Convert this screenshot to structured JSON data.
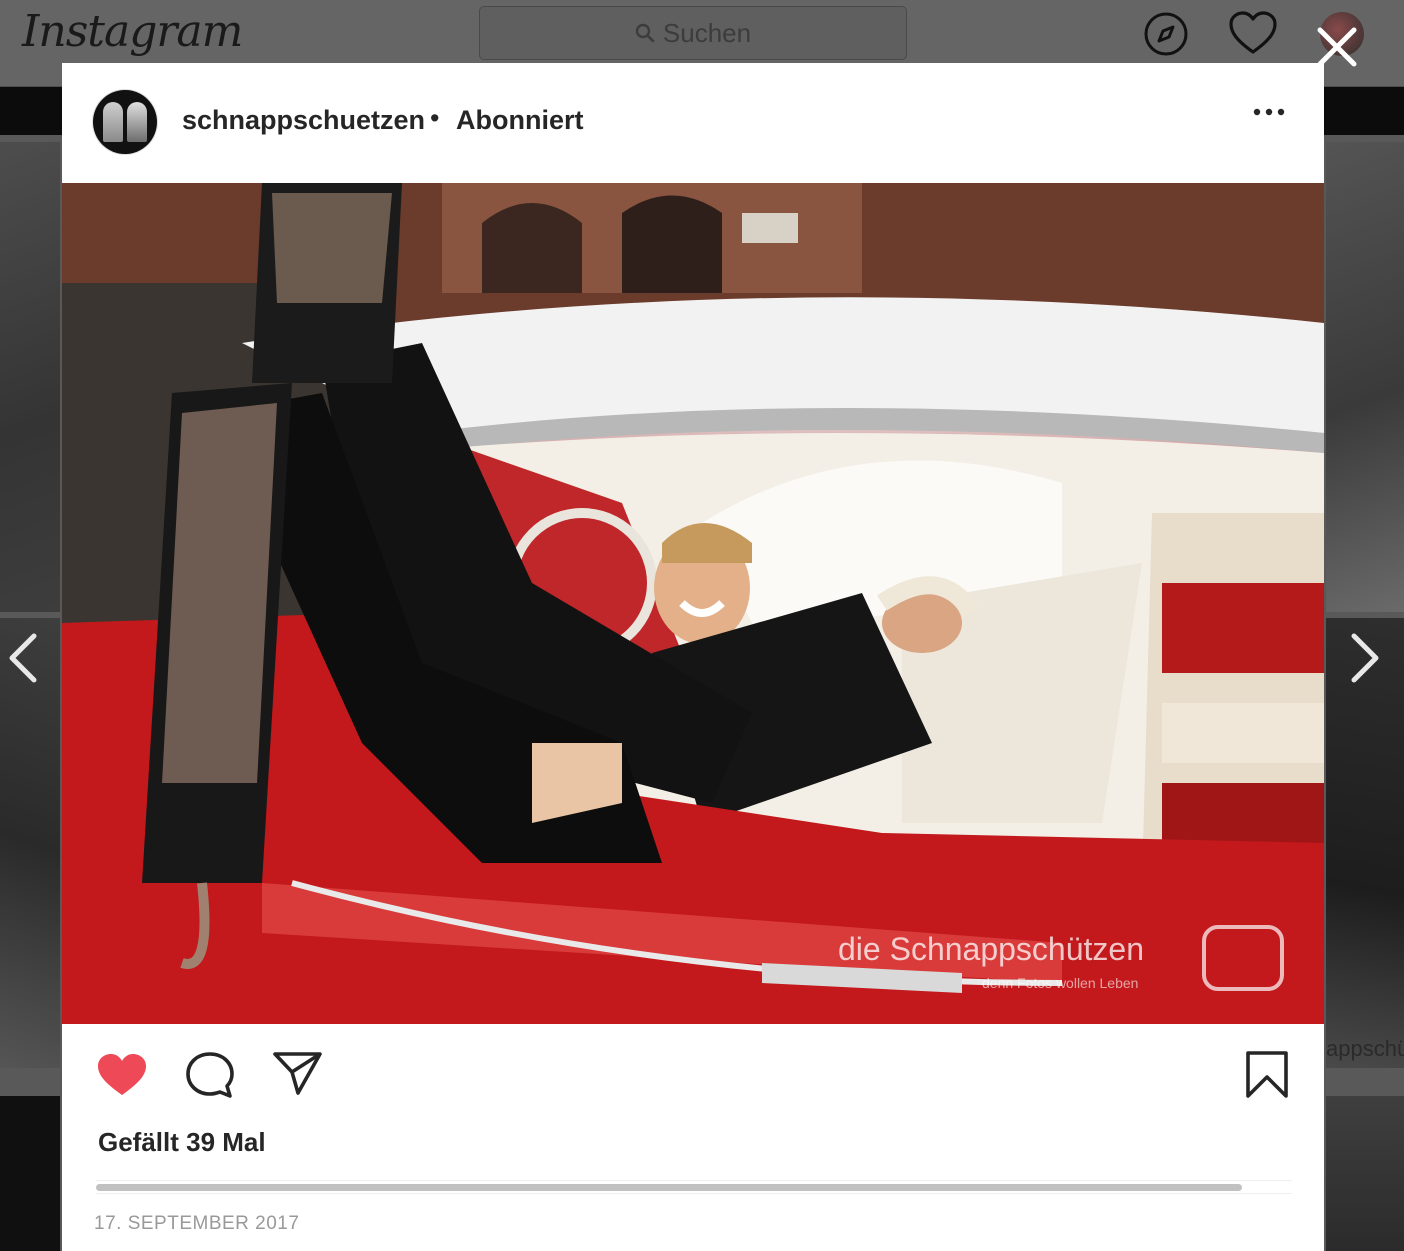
{
  "app": {
    "logo_text": "Instagram",
    "search_placeholder": "Suchen"
  },
  "background": {
    "right_partial_text": "appschü"
  },
  "post": {
    "username": "schnappschuetzen",
    "separator": "•",
    "follow_status": "Abonniert",
    "photo": {
      "watermark": "die Schnappschützen",
      "watermark_tagline": "denn Fotos wollen Leben"
    },
    "liked": true,
    "likes_text": "Gefällt 39 Mal",
    "date": "17. SEPTEMBER 2017"
  },
  "colors": {
    "like_red": "#ed4956",
    "text_dark": "#262626",
    "text_muted": "#999999",
    "overlay": "#595959"
  },
  "icons": {
    "search": "search-icon",
    "explore": "compass-icon",
    "activity": "heart-outline-icon",
    "close": "close-icon",
    "more": "more-options-icon",
    "like": "heart-filled-icon",
    "comment": "comment-icon",
    "share": "paper-plane-icon",
    "save": "bookmark-icon",
    "prev": "chevron-left-icon",
    "next": "chevron-right-icon"
  }
}
